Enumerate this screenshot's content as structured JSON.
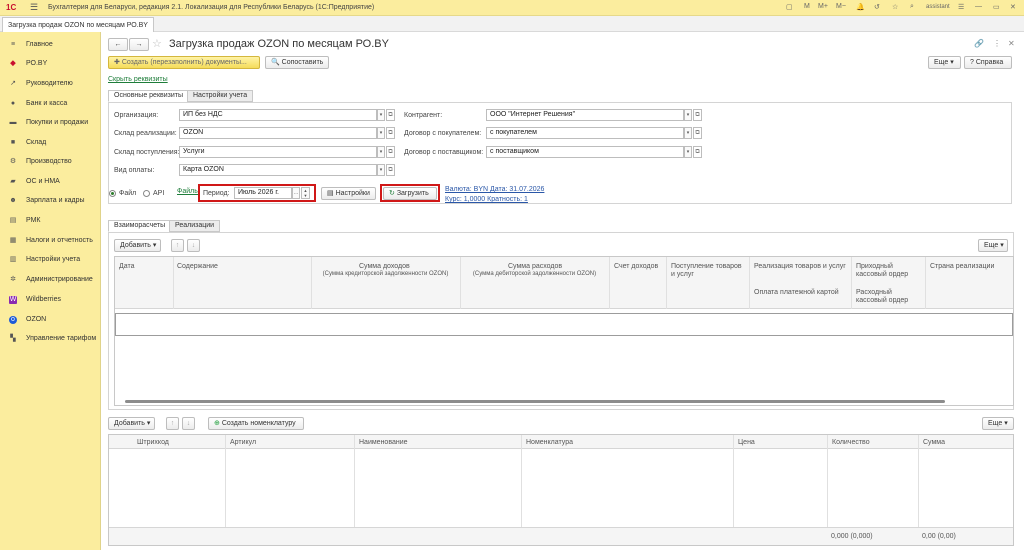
{
  "titlebar": {
    "app_title": "Бухгалтерия для Беларуси, редакция 2.1. Локализация для Республики Беларусь (1С:Предприятие)",
    "user": "assistant",
    "logo": "1С"
  },
  "open_tab": "Загрузка продаж OZON по месяцам РО.BY",
  "sidebar": {
    "items": [
      {
        "label": "Главное",
        "icon": "menu-icon"
      },
      {
        "label": "РО.BY",
        "icon": "ro-icon"
      },
      {
        "label": "Руководителю",
        "icon": "chart-icon"
      },
      {
        "label": "Банк и касса",
        "icon": "bank-icon"
      },
      {
        "label": "Покупки и продажи",
        "icon": "cart-icon"
      },
      {
        "label": "Склад",
        "icon": "warehouse-icon"
      },
      {
        "label": "Производство",
        "icon": "factory-icon"
      },
      {
        "label": "ОС и НМА",
        "icon": "assets-icon"
      },
      {
        "label": "Зарплата и кадры",
        "icon": "people-icon"
      },
      {
        "label": "РМК",
        "icon": "pos-icon"
      },
      {
        "label": "Налоги и отчетность",
        "icon": "tax-icon"
      },
      {
        "label": "Настройки учета",
        "icon": "settings-icon"
      },
      {
        "label": "Администрирование",
        "icon": "gear-icon"
      },
      {
        "label": "Wildberries",
        "icon": "wildberries-icon"
      },
      {
        "label": "OZON",
        "icon": "ozon-icon"
      },
      {
        "label": "Управление тарифом",
        "icon": "tariff-icon"
      }
    ]
  },
  "form": {
    "title": "Загрузка продаж OZON по месяцам РО.BY",
    "create_docs_button": "Создать (перезаполнить) документы...",
    "compare_button": "Сопоставить",
    "more_button": "Еще",
    "help_button": "Справка",
    "hide_requisites_link": "Скрыть реквизиты",
    "tabs": [
      "Основные реквизиты",
      "Настройки учета"
    ],
    "fields": {
      "organization": {
        "label": "Организация:",
        "value": "ИП без НДС"
      },
      "sale_warehouse": {
        "label": "Склад реализации:",
        "value": "OZON"
      },
      "receipt_warehouse": {
        "label": "Склад поступления:",
        "value": "Услуги"
      },
      "payment_type": {
        "label": "Вид оплаты:",
        "value": "Карта OZON"
      },
      "counterparty": {
        "label": "Контрагент:",
        "value": "ООО \"Интернет Решения\""
      },
      "buyer_contract": {
        "label": "Договор с покупателем:",
        "value": "с покупателем"
      },
      "supplier_contract": {
        "label": "Договор с поставщиком:",
        "value": "с поставщиком"
      }
    },
    "source": {
      "file_label": "Файл",
      "api_label": "API",
      "files_link": "Файлы",
      "period_label": "Период:",
      "period_value": "Июль 2026 г.",
      "settings_button": "Настройки",
      "load_button": "Загрузить",
      "currency_info": "Валюта: BYN Дата: 31.07.2026",
      "rate_info": "Курс: 1,0000 Кратность: 1"
    },
    "lower_tabs": [
      "Взаиморасчеты",
      "Реализации"
    ],
    "grid1": {
      "add_button": "Добавить",
      "more_button": "Еще",
      "columns": {
        "date": "Дата",
        "content": "Содержание",
        "income_sum": "Сумма доходов",
        "income_sub": "(Сумма кредиторской задолженности OZON)",
        "expense_sum": "Сумма расходов",
        "expense_sub": "(Сумма дебиторской задолженности OZON)",
        "income_account": "Счет доходов",
        "receipt_goods": "Поступление товаров и услуг",
        "sale_goods": "Реализация товаров и услуг",
        "card_payment": "Оплата платежной картой",
        "cash_in": "Приходный кассовый ордер",
        "cash_out": "Расходный кассовый ордер",
        "country": "Страна реализации"
      }
    },
    "grid2": {
      "add_button": "Добавить",
      "create_item_button": "Создать номенклатуру",
      "more_button": "Еще",
      "columns": {
        "barcode": "Штрихкод",
        "article": "Артикул",
        "name": "Наименование",
        "item": "Номенклатура",
        "price": "Цена",
        "quantity": "Количество",
        "sum": "Сумма"
      },
      "totals": {
        "quantity": "0,000 (0,000)",
        "sum": "0,00 (0,00)"
      }
    }
  }
}
